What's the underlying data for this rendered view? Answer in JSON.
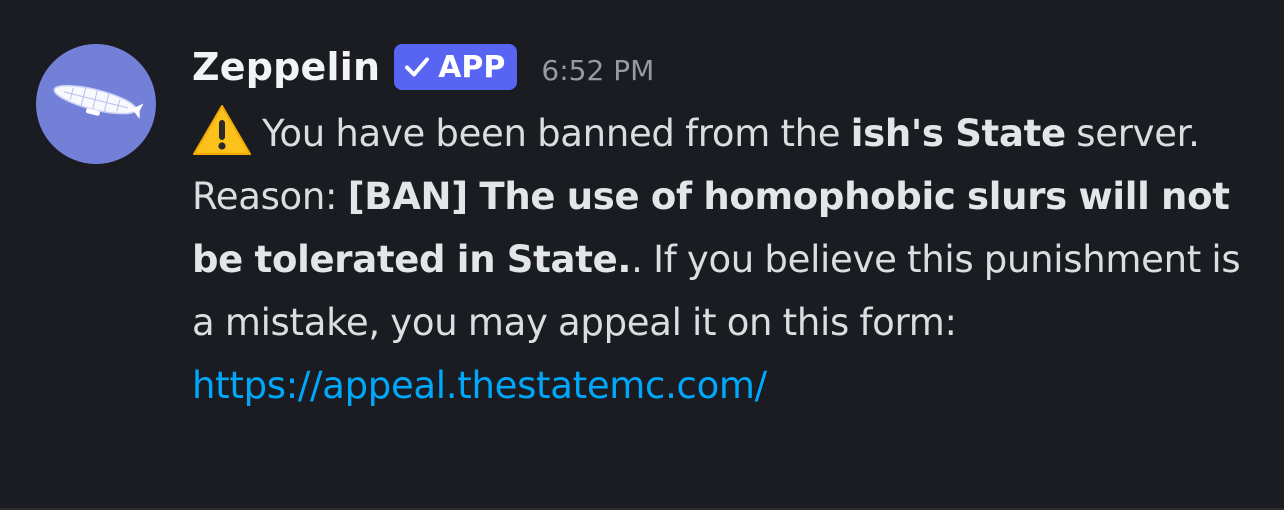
{
  "message": {
    "author": "Zeppelin",
    "badge": {
      "label": "APP",
      "icon": "check-icon"
    },
    "timestamp": "6:52 PM",
    "avatar_icon": "zeppelin-airship-icon",
    "warning_icon": "warning-icon",
    "text": {
      "part1": "You have been banned from the ",
      "server_name": "ish's State",
      "part2": " server. Reason: ",
      "reason": "[BAN] The use of homophobic slurs will not be tolerated in State.",
      "part3": ". If you believe this punishment is a mistake, you may appeal it on this form: ",
      "appeal_link": "https://appeal.thestatemc.com/"
    }
  },
  "colors": {
    "background": "#1b1c21",
    "avatar": "#7280d8",
    "badge": "#5865f2",
    "link": "#00a8fc",
    "timestamp": "#949ba4"
  }
}
